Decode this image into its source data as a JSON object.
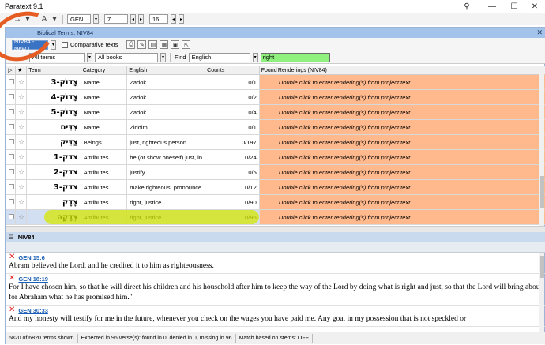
{
  "app": {
    "title": "Paratext 9.1"
  },
  "window_controls": {
    "pin": "⚲",
    "minimize": "—",
    "maximize": "☐",
    "close": "✕"
  },
  "nav": {
    "back": "←",
    "forward": "→",
    "menu": "A",
    "book": "GEN",
    "chapter": "7",
    "verse": "16"
  },
  "panel": {
    "title": "Biblical Terms: NIV84",
    "project_select": "NIV84 - New I",
    "comparative_texts": "Comparative texts",
    "filter_terms": "All terms",
    "filter_books": "All books",
    "find_label": "Find",
    "language": "English",
    "search_value": "right"
  },
  "table": {
    "columns": [
      "Term",
      "Category",
      "English",
      "Counts",
      "Found",
      "Renderings (NIV84)"
    ],
    "rows": [
      {
        "term": "צָדוֹק-3",
        "category": "Name",
        "english": "Zadok",
        "counts": "0/1",
        "rendering": "Double click to enter rendering(s) from project text"
      },
      {
        "term": "צָדוֹק-4",
        "category": "Name",
        "english": "Zadok",
        "counts": "0/2",
        "rendering": "Double click to enter rendering(s) from project text"
      },
      {
        "term": "צָדוֹק-5",
        "category": "Name",
        "english": "Zadok",
        "counts": "0/4",
        "rendering": "Double click to enter rendering(s) from project text"
      },
      {
        "term": "צִדִּים",
        "category": "Name",
        "english": "Ziddim",
        "counts": "0/1",
        "rendering": "Double click to enter rendering(s) from project text"
      },
      {
        "term": "צַדִּיק",
        "category": "Beings",
        "english": "just, righteous person",
        "counts": "0/197",
        "rendering": "Double click to enter rendering(s) from project text"
      },
      {
        "term": "צדק-1",
        "category": "Attributes",
        "english": "be (or show oneself) just, in...",
        "counts": "0/24",
        "rendering": "Double click to enter rendering(s) from project text"
      },
      {
        "term": "צדק-2",
        "category": "Attributes",
        "english": "justify",
        "counts": "0/5",
        "rendering": "Double click to enter rendering(s) from project text"
      },
      {
        "term": "צדק-3",
        "category": "Attributes",
        "english": "make righteous, pronounce...",
        "counts": "0/12",
        "rendering": "Double click to enter rendering(s) from project text"
      },
      {
        "term": "צֶדֶק",
        "category": "Attributes",
        "english": "right, justice",
        "counts": "0/90",
        "rendering": "Double click to enter rendering(s) from project text"
      },
      {
        "term": "צְדָקָה",
        "category": "Attributes",
        "english": "right, justice",
        "counts": "0/96",
        "rendering": "Double click to enter rendering(s) from project text"
      }
    ]
  },
  "niv": {
    "header": "NIV84"
  },
  "verses": [
    {
      "ref": "GEN 15:6",
      "text": "Abram believed the Lord, and he credited it to him as righteousness."
    },
    {
      "ref": "GEN 18:19",
      "text": "For I have chosen him, so that he will direct his children and his household after him to keep the way of the Lord by doing what is right and just, so that the Lord will bring about for Abraham what he has promised him.\""
    },
    {
      "ref": "GEN 30:33",
      "text": "And my honesty will testify for me in the future, whenever you check on the wages you have paid me. Any goat in my possession that is not speckled or"
    }
  ],
  "status": {
    "terms_shown": "6820 of 6820 terms shown",
    "expected": "Expected in 96 verse(s): found in 0, denied in 0, missing in 96",
    "match": "Match based on stems: OFF"
  },
  "colors": {
    "rendering_bg": "#ffb98d",
    "search_bg": "#8ff07d",
    "title_bar": "#a4c3ea",
    "annotation_circle": "#e65d24",
    "annotation_highlight": "#d6e700"
  }
}
